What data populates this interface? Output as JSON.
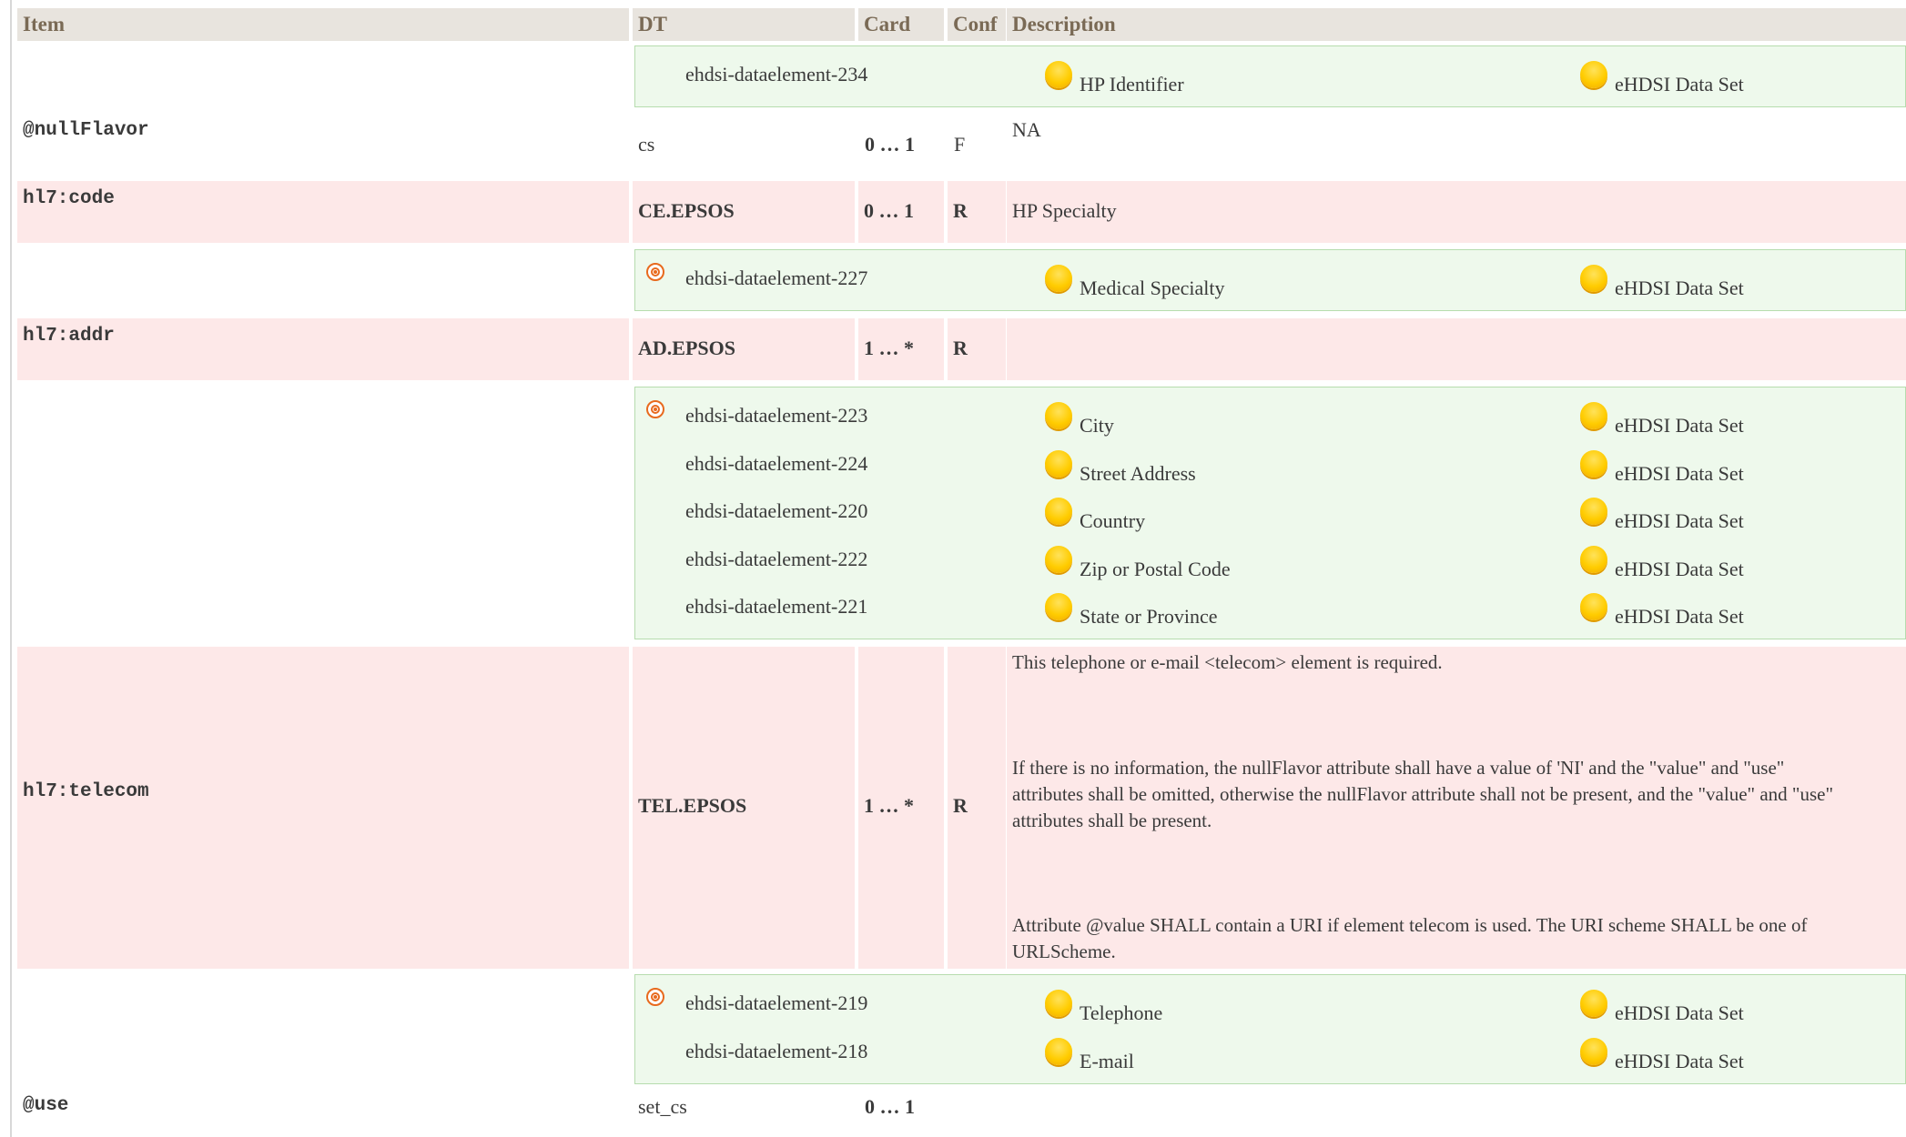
{
  "columns": {
    "item": "Item",
    "dt": "DT",
    "card": "Card",
    "conf": "Conf",
    "description": "Description"
  },
  "rows": {
    "nullflavor": {
      "item": "@nullFlavor",
      "dt": "cs",
      "card": "0 … 1",
      "conf": "F",
      "description": "NA"
    },
    "code": {
      "item": "hl7:code",
      "dt": "CE.EPSOS",
      "card": "0 … 1",
      "conf": "R",
      "description": "HP Specialty"
    },
    "addr": {
      "item": "hl7:addr",
      "dt": "AD.EPSOS",
      "card": "1 … *",
      "conf": "R",
      "description": ""
    },
    "telecom": {
      "item": "hl7:telecom",
      "dt": "TEL.EPSOS",
      "card": "1 … *",
      "conf": "R",
      "description_p1": "This telephone or e-mail <telecom> element is required.",
      "description_p2_l1": "If there is no information, the nullFlavor attribute shall have a value of 'NI' and the \"value\" and \"use\"",
      "description_p2_l2": "attributes shall be omitted, otherwise the nullFlavor attribute shall not be present, and the \"value\" and \"use\"",
      "description_p2_l3": "attributes shall be present.",
      "description_p3_l1": "Attribute @value SHALL contain a URI if element telecom is used. The URI scheme SHALL be one of",
      "description_p3_l2": "URLScheme."
    },
    "use": {
      "item": "@use",
      "dt": "set_cs",
      "card": "0 … 1"
    }
  },
  "concepts": {
    "g0": [
      {
        "id": "ehdsi-dataelement-234",
        "name": "HP Identifier",
        "dataset": "eHDSI Data Set"
      }
    ],
    "g1": [
      {
        "id": "ehdsi-dataelement-227",
        "name": "Medical Specialty",
        "dataset": "eHDSI Data Set"
      }
    ],
    "g2": [
      {
        "id": "ehdsi-dataelement-223",
        "name": "City",
        "dataset": "eHDSI Data Set"
      },
      {
        "id": "ehdsi-dataelement-224",
        "name": "Street Address",
        "dataset": "eHDSI Data Set"
      },
      {
        "id": "ehdsi-dataelement-220",
        "name": "Country",
        "dataset": "eHDSI Data Set"
      },
      {
        "id": "ehdsi-dataelement-222",
        "name": "Zip or Postal Code",
        "dataset": "eHDSI Data Set"
      },
      {
        "id": "ehdsi-dataelement-221",
        "name": "State or Province",
        "dataset": "eHDSI Data Set"
      }
    ],
    "g3": [
      {
        "id": "ehdsi-dataelement-219",
        "name": "Telephone",
        "dataset": "eHDSI Data Set"
      },
      {
        "id": "ehdsi-dataelement-218",
        "name": "E-mail",
        "dataset": "eHDSI Data Set"
      }
    ]
  },
  "icons": {
    "concept": "sun-icon",
    "anchor": "target-icon"
  },
  "colors": {
    "header_bg": "#e8e4de",
    "row_pink": "#fde8e8",
    "concept_green": "#eef9ec",
    "accent": "#e86a1e"
  }
}
